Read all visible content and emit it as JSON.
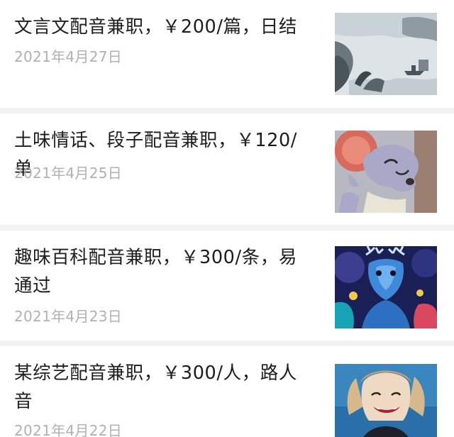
{
  "feed": {
    "items": [
      {
        "title": "文言文配音兼职，￥200/篇，日结",
        "date": "2021年4月27日",
        "thumbnail_icon": "ink-landscape-painting"
      },
      {
        "title": "土味情话、段子配音兼职，￥120/单",
        "date": "2021年4月25日",
        "thumbnail_icon": "cartoon-mouse"
      },
      {
        "title": "趣味百科配音兼职，￥300/条，易通过",
        "date": "2021年4月23日",
        "thumbnail_icon": "blue-deer-illustration"
      },
      {
        "title": "某综艺配音兼职，￥300/人，路人音",
        "date": "2021年4月22日",
        "thumbnail_icon": "smiling-woman-photo"
      }
    ]
  },
  "colors": {
    "page_background": "#f2f2f4",
    "card_background": "#ffffff",
    "title_text": "#1d1d1f",
    "date_text": "#b0b0b4"
  }
}
